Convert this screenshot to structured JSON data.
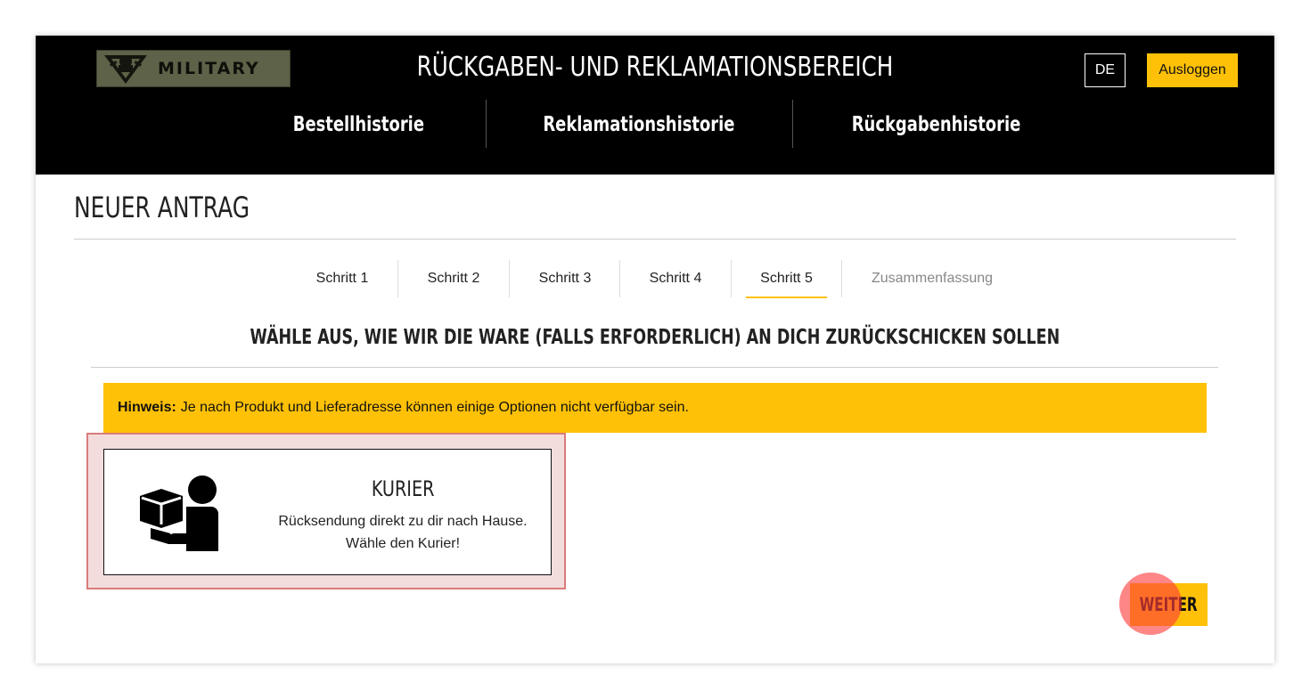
{
  "header": {
    "logo_text": "MILITARY",
    "title": "RÜCKGABEN- UND REKLAMATIONSBEREICH",
    "language": "DE",
    "logout_label": "Ausloggen",
    "nav": [
      {
        "label": "Bestellhistorie"
      },
      {
        "label": "Reklamationshistorie"
      },
      {
        "label": "Rückgabenhistorie"
      }
    ]
  },
  "page": {
    "title": "NEUER ANTRAG",
    "steps": [
      {
        "label": "Schritt 1"
      },
      {
        "label": "Schritt 2"
      },
      {
        "label": "Schritt 3"
      },
      {
        "label": "Schritt 4"
      },
      {
        "label": "Schritt 5"
      },
      {
        "label": "Zusammenfassung"
      }
    ],
    "active_step": "Schritt 5",
    "section_heading": "WÄHLE AUS, WIE WIR DIE WARE (FALLS ERFORDERLICH) AN DICH ZURÜCKSCHICKEN SOLLEN",
    "notice": {
      "label": "Hinweis:",
      "text": "Je nach Produkt und Lieferadresse können einige Optionen nicht verfügbar sein."
    },
    "option": {
      "icon": "courier-icon",
      "title": "KURIER",
      "desc_line1": "Rücksendung direkt zu dir nach Hause.",
      "desc_line2": "Wähle den Kurier!"
    },
    "next_label": "WEITER"
  },
  "colors": {
    "accent": "#ffc107",
    "header_bg": "#000000",
    "selection_bg": "#f3dcdc",
    "selection_border": "#d97b7b"
  }
}
